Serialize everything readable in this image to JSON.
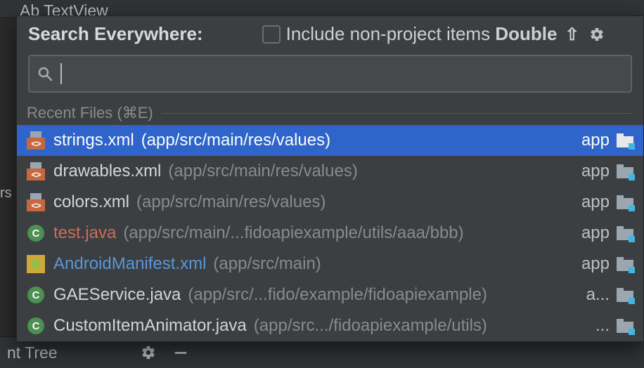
{
  "background": {
    "top_tab_label": "Ab TextView",
    "left_truncated_text": "rs",
    "bottom_panel_label": "nt Tree"
  },
  "popup": {
    "title": "Search Everywhere:",
    "checkbox_label_prefix": "Include non-project items ",
    "checkbox_bold": "Double",
    "shift_glyph": "⇧",
    "section_label": "Recent Files (⌘E)",
    "module_label_default": "app",
    "results": [
      {
        "icon": "xml",
        "name": "strings.xml",
        "name_style": "",
        "path": "(app/src/main/res/values)",
        "module": "app",
        "selected": true
      },
      {
        "icon": "xml",
        "name": "drawables.xml",
        "name_style": "",
        "path": "(app/src/main/res/values)",
        "module": "app",
        "selected": false
      },
      {
        "icon": "xml",
        "name": "colors.xml",
        "name_style": "",
        "path": "(app/src/main/res/values)",
        "module": "app",
        "selected": false
      },
      {
        "icon": "class",
        "name": "test.java",
        "name_style": "red",
        "path": "(app/src/main/...fidoapiexample/utils/aaa/bbb)",
        "module": "app",
        "selected": false
      },
      {
        "icon": "manifest",
        "name": "AndroidManifest.xml",
        "name_style": "blue",
        "path": "(app/src/main)",
        "module": "app",
        "selected": false
      },
      {
        "icon": "class",
        "name": "GAEService.java",
        "name_style": "",
        "path": "(app/src/...fido/example/fidoapiexample)",
        "module": "a...",
        "selected": false
      },
      {
        "icon": "class",
        "name": "CustomItemAnimator.java",
        "name_style": "",
        "path": "(app/src.../fidoapiexample/utils)",
        "module": "...",
        "selected": false
      }
    ]
  }
}
